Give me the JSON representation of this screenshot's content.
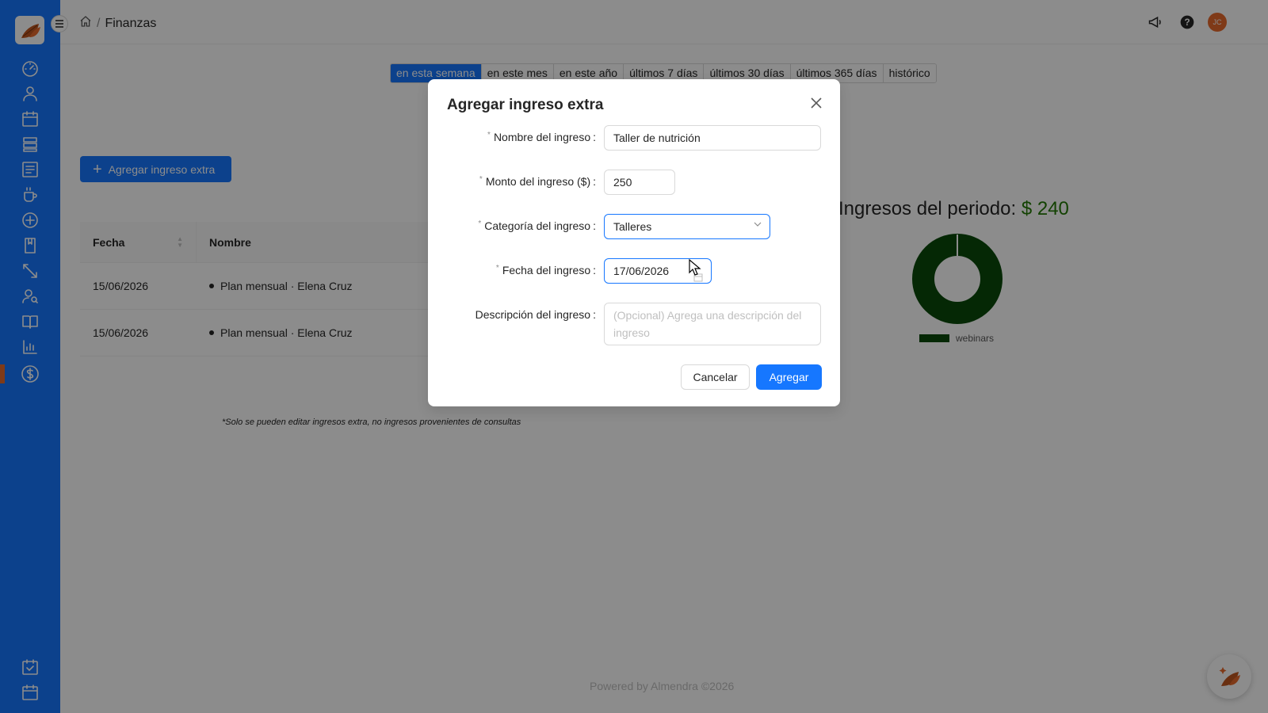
{
  "header": {
    "breadcrumb_page": "Finanzas",
    "breadcrumb_sep": "/",
    "avatar_initials": "JC"
  },
  "period_tabs": [
    {
      "label": "en esta semana",
      "active": true
    },
    {
      "label": "en este mes"
    },
    {
      "label": "en este año"
    },
    {
      "label": "últimos 7 días"
    },
    {
      "label": "últimos 30 días"
    },
    {
      "label": "últimos 365 días"
    },
    {
      "label": "histórico"
    }
  ],
  "toolbar": {
    "add_button_label": "Agregar ingreso extra"
  },
  "table": {
    "headers": {
      "fecha": "Fecha",
      "nombre": "Nombre"
    },
    "rows": [
      {
        "fecha": "15/06/2026",
        "nombre": "Plan mensual · Elena Cruz"
      },
      {
        "fecha": "15/06/2026",
        "nombre": "Plan mensual · Elena Cruz"
      }
    ],
    "footnote": "*Solo se pueden editar ingresos extra, no ingresos provenientes de consultas"
  },
  "income": {
    "title": "Ingresos del periodo:",
    "amount": "$ 240",
    "legend_label": "webinars",
    "donut_color": "#0a4a0a"
  },
  "footer": {
    "powered_by": "Powered by Almendra ©2026"
  },
  "modal": {
    "title": "Agregar ingreso extra",
    "fields": {
      "nombre": {
        "label": "Nombre del ingreso",
        "value": "Taller de nutrición"
      },
      "monto": {
        "label": "Monto del ingreso ($)",
        "value": "250"
      },
      "categoria": {
        "label": "Categoría del ingreso",
        "value": "Talleres"
      },
      "fecha": {
        "label": "Fecha del ingreso",
        "value": "17/06/2026"
      },
      "descripcion": {
        "label": "Descripción del ingreso",
        "placeholder": "(Opcional) Agrega una descripción del ingreso"
      }
    },
    "cancel_label": "Cancelar",
    "submit_label": "Agregar",
    "required_mark": "*",
    "colon": ":"
  },
  "colors": {
    "primary": "#1677ff",
    "accent": "#e86a2c",
    "income_green": "#237804"
  }
}
